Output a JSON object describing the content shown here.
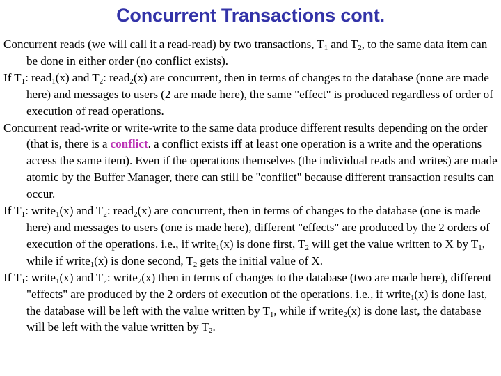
{
  "slide": {
    "title": "Concurrent Transactions cont.",
    "title_color": "#3333a8",
    "background_color": "#ffffff",
    "text_color": "#000000",
    "highlight_color": "#bb33b5",
    "paragraphs": [
      {
        "id": "p1",
        "runs": [
          {
            "text": "Concurrent reads (we will call it a read-read) by two transactions, T"
          },
          {
            "text": "1",
            "style": "sub"
          },
          {
            "text": " and T"
          },
          {
            "text": "2",
            "style": "sub"
          },
          {
            "text": ", to the same data item can be done in either order (no conflict exists)."
          }
        ]
      },
      {
        "id": "p2",
        "runs": [
          {
            "text": "If T"
          },
          {
            "text": "1",
            "style": "sub"
          },
          {
            "text": ": read"
          },
          {
            "text": "1",
            "style": "sub"
          },
          {
            "text": "(x) and T"
          },
          {
            "text": "2",
            "style": "sub"
          },
          {
            "text": ": read"
          },
          {
            "text": "2",
            "style": "sub"
          },
          {
            "text": "(x) are concurrent, then in terms of changes to the database (none are made here) and messages to users (2 are made here), the same \"effect\" is produced regardless of order of execution of read operations."
          }
        ]
      },
      {
        "id": "p3",
        "runs": [
          {
            "text": "Concurrent read-write or write-write to the same data produce different results depending on the order (that is, there is a "
          },
          {
            "text": "conflict",
            "style": "highlight"
          },
          {
            "text": ".  a conflict exists iff at least one operation is a write and the operations access the same item).  Even if the operations themselves (the individual reads and writes) are made atomic by the Buffer Manager, there can still be \"conflict\" because different transaction results can occur."
          }
        ]
      },
      {
        "id": "p4",
        "runs": [
          {
            "text": "If T"
          },
          {
            "text": "1",
            "style": "sub"
          },
          {
            "text": ": write"
          },
          {
            "text": "1",
            "style": "sub"
          },
          {
            "text": "(x) and T"
          },
          {
            "text": "2",
            "style": "sub"
          },
          {
            "text": ": read"
          },
          {
            "text": "2",
            "style": "sub"
          },
          {
            "text": "(x) are concurrent, then in terms of changes to the database (one is made here) and messages to users (one is made here), different \"effects\" are produced by the 2 orders of execution of the operations. i.e., if write"
          },
          {
            "text": "1",
            "style": "sub"
          },
          {
            "text": "(x) is done first, T"
          },
          {
            "text": "2",
            "style": "sub"
          },
          {
            "text": " will get the value written to X by T"
          },
          {
            "text": "1",
            "style": "sub"
          },
          {
            "text": ", while if write"
          },
          {
            "text": "1",
            "style": "sub"
          },
          {
            "text": "(x) is done second, T"
          },
          {
            "text": "2",
            "style": "sub"
          },
          {
            "text": " gets the initial value of X."
          }
        ]
      },
      {
        "id": "p5",
        "runs": [
          {
            "text": "If T"
          },
          {
            "text": "1",
            "style": "sub"
          },
          {
            "text": ": write"
          },
          {
            "text": "1",
            "style": "sub"
          },
          {
            "text": "(x) and T"
          },
          {
            "text": "2",
            "style": "sub"
          },
          {
            "text": ": write"
          },
          {
            "text": "2",
            "style": "sub"
          },
          {
            "text": "(x) then in terms of changes to the database (two are made here), different \"effects\" are produced by the 2 orders of execution of the operations.  i.e., if write"
          },
          {
            "text": "1",
            "style": "sub"
          },
          {
            "text": "(x) is done last, the database will be left with the value written by T"
          },
          {
            "text": "1",
            "style": "sub"
          },
          {
            "text": ", while if write"
          },
          {
            "text": "2",
            "style": "sub"
          },
          {
            "text": "(x) is done last, the database will be left with the value written by T"
          },
          {
            "text": "2",
            "style": "sub"
          },
          {
            "text": "."
          }
        ]
      }
    ]
  }
}
